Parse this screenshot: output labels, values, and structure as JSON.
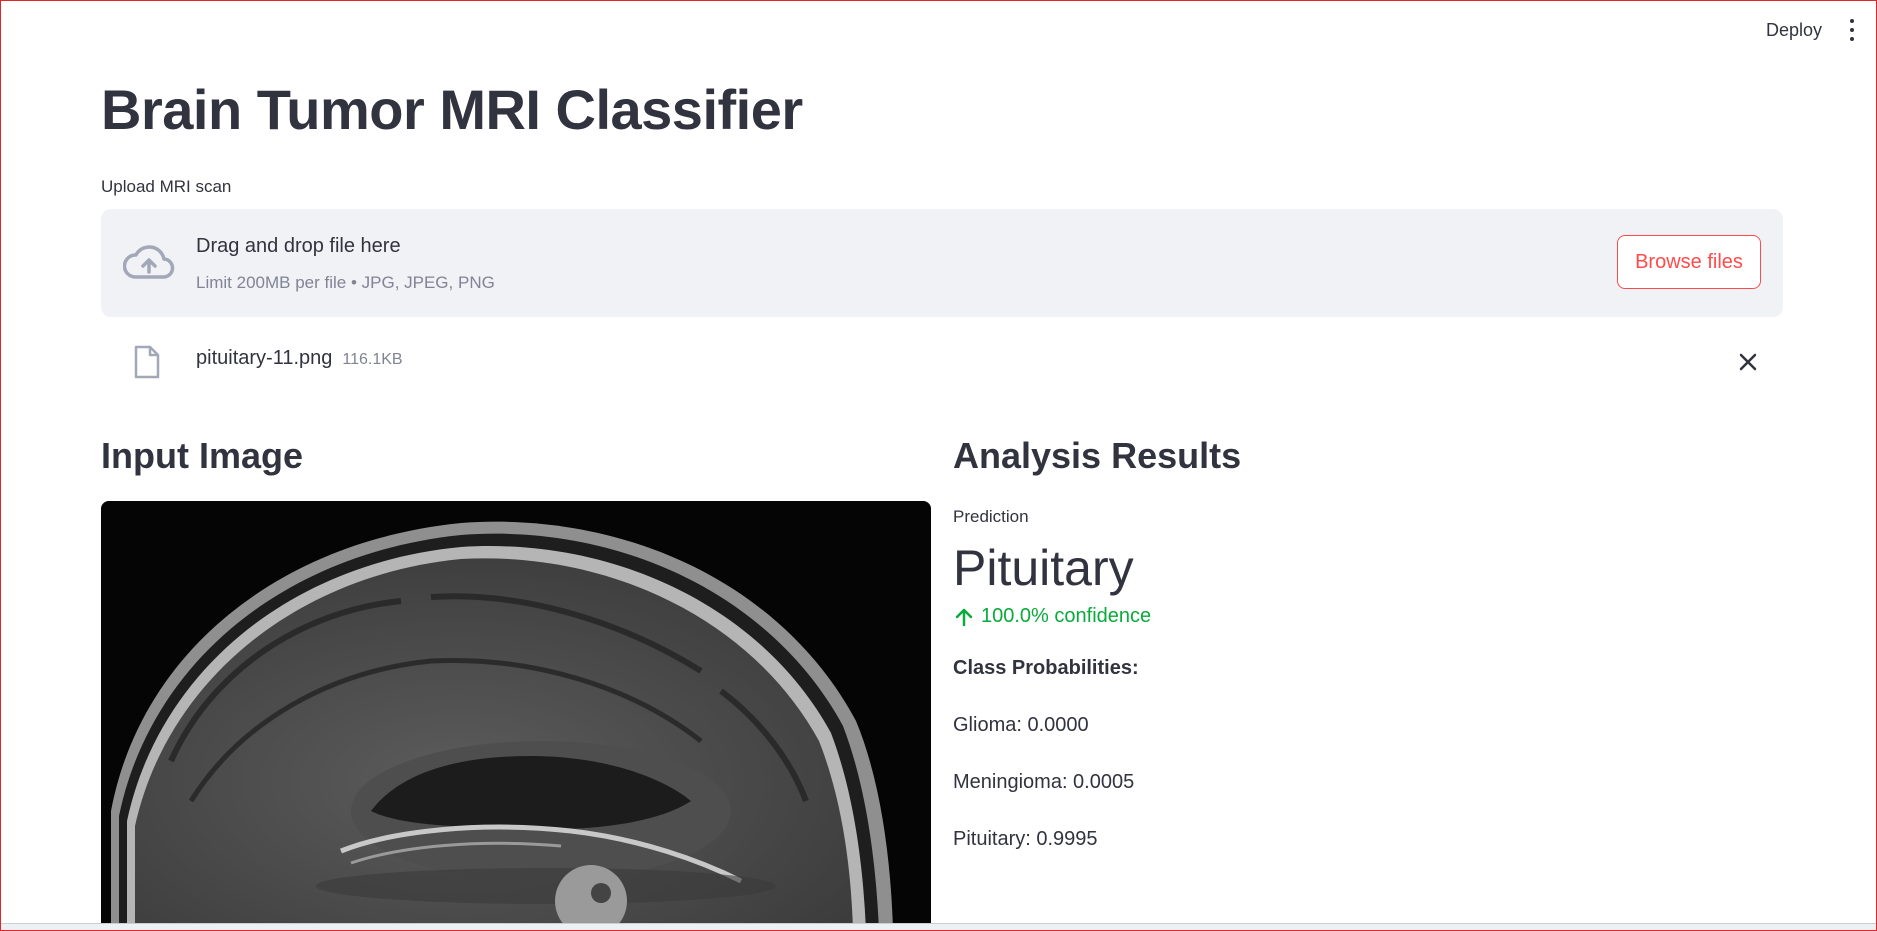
{
  "toolbar": {
    "deploy_label": "Deploy",
    "menu_icon": "kebab-menu-icon"
  },
  "page": {
    "title": "Brain Tumor MRI Classifier"
  },
  "uploader": {
    "label": "Upload MRI scan",
    "drop_text": "Drag and drop file here",
    "limit_text": "Limit 200MB per file • JPG, JPEG, PNG",
    "browse_label": "Browse files",
    "icon": "cloud-upload-icon"
  },
  "file": {
    "name": "pituitary-11.png",
    "size": "116.1KB",
    "icon": "file-icon"
  },
  "input_section": {
    "heading": "Input Image"
  },
  "results": {
    "heading": "Analysis Results",
    "metric_label": "Prediction",
    "metric_value": "Pituitary",
    "delta": "100.0% confidence",
    "delta_color": "#09ab3b",
    "probabilities_title": "Class Probabilities:",
    "probabilities": [
      {
        "text": "Glioma: 0.0000"
      },
      {
        "text": "Meningioma: 0.0005"
      },
      {
        "text": "Pituitary: 0.9995"
      }
    ]
  },
  "colors": {
    "accent": "#ff4b4b",
    "text": "#31333f",
    "dropzone_bg": "#f0f2f6"
  }
}
